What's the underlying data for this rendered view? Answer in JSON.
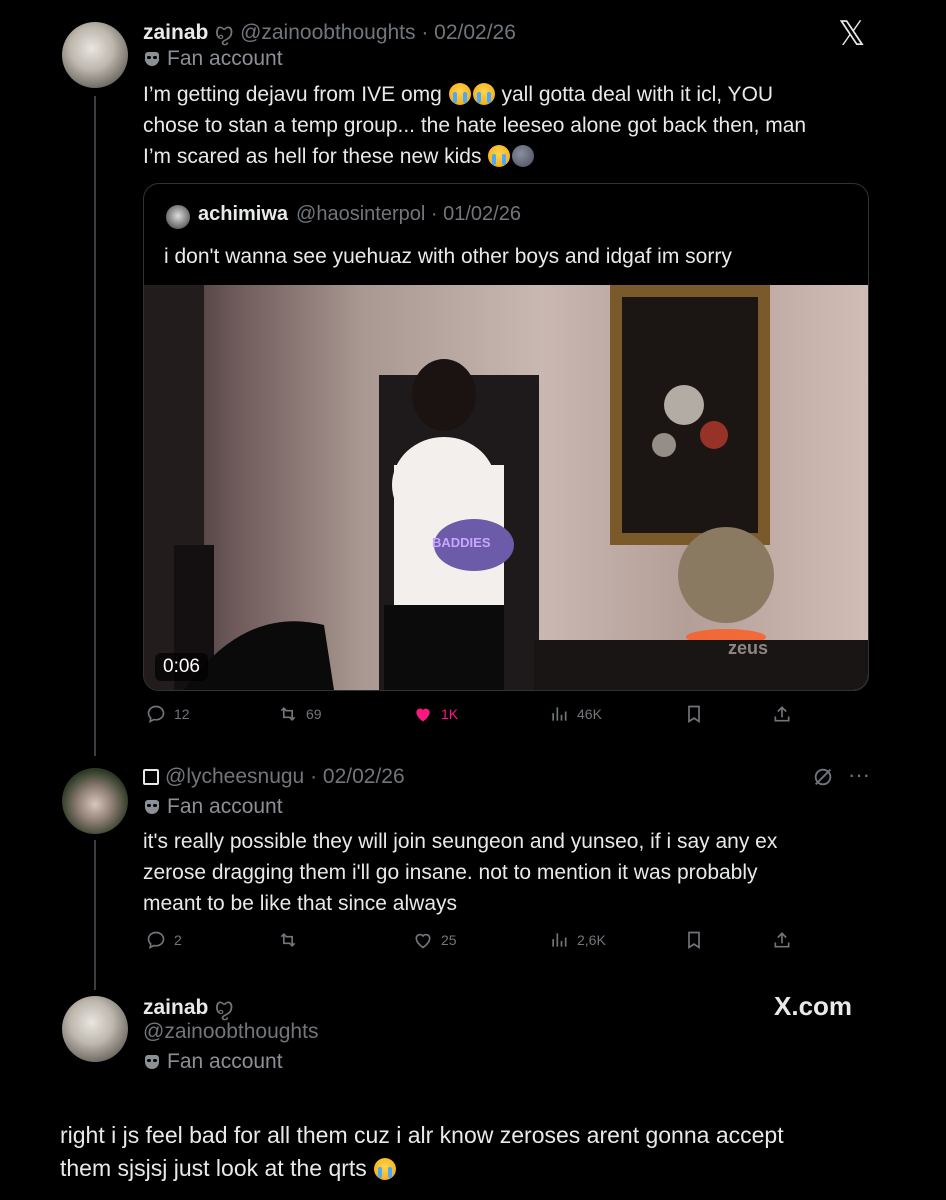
{
  "tweet1": {
    "name": "zainab",
    "name_suffix": "ꨄ",
    "handle_date": "@zainoobthoughts · 02/02/26",
    "badge": "Fan account",
    "text_l1": "I’m getting dejavu from IVE omg",
    "text_l1b": "yall gotta deal with it icl, YOU",
    "text_l2": "chose to stan a temp group... the hate leeseo alone got back then, man",
    "text_l3": "I’m scared as hell for these new kids",
    "x_logo": "𝕏"
  },
  "quote": {
    "name": "achimiwa",
    "handle_date": "@haosinterpol · 01/02/26",
    "text": "i don't wanna see yuehuaz with other boys and idgaf im sorry",
    "video_time": "0:06",
    "watermark": "zeus",
    "shirt_text": "BADDIES"
  },
  "actions1": {
    "replies": "12",
    "reposts": "69",
    "likes": "1K",
    "views": "46K"
  },
  "tweet2": {
    "handle_date": "@lycheesnugu · 02/02/26",
    "badge": "Fan account",
    "text_l1": "it's really possible they will join seungeon and yunseo, if i say any ex",
    "text_l2": "zerose dragging them i'll go insane. not to mention it was probably",
    "text_l3": "meant to be like that since always"
  },
  "actions2": {
    "replies": "2",
    "reposts": "",
    "likes": "25",
    "views": "2,6K"
  },
  "tweet3": {
    "name": "zainab",
    "name_suffix": "ꨄ",
    "handle": "@zainoobthoughts",
    "badge": "Fan account",
    "brand": "X.com"
  },
  "caption": {
    "l1": "right i js feel bad for all them cuz i alr know zeroses arent gonna accept",
    "l2": "them sjsjsj just look at the qrts"
  },
  "colors": {
    "like_active": "#f91880",
    "muted": "#71767b",
    "text": "#e7e9ea"
  }
}
